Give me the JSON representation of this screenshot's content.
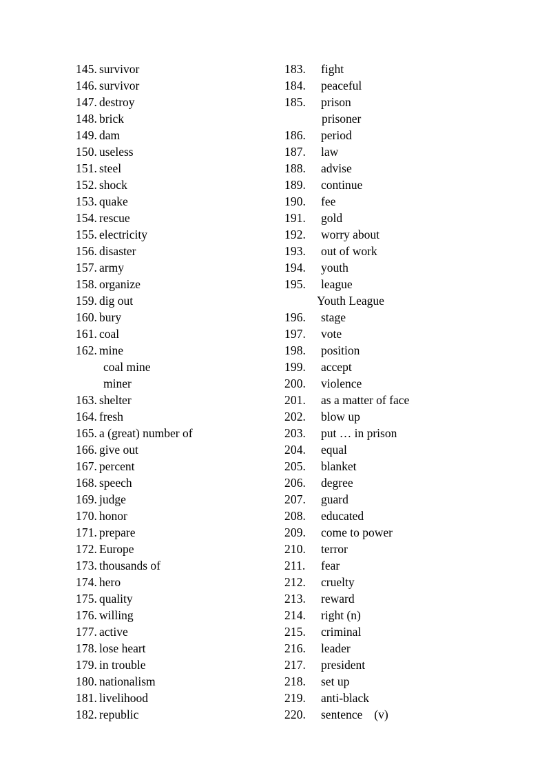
{
  "document": {
    "type": "vocabulary-word-list",
    "page_background": "#ffffff",
    "text_color": "#000000",
    "column_count": 2
  },
  "columns": [
    {
      "name": "left-column",
      "entries": [
        {
          "num": "145.",
          "word": "survivor"
        },
        {
          "num": "146.",
          "word": "survivor"
        },
        {
          "num": "147.",
          "word": "destroy"
        },
        {
          "num": "148.",
          "word": "brick"
        },
        {
          "num": "149.",
          "word": "dam"
        },
        {
          "num": "150.",
          "word": "useless"
        },
        {
          "num": "151.",
          "word": "steel"
        },
        {
          "num": "152.",
          "word": "shock"
        },
        {
          "num": "153.",
          "word": "quake"
        },
        {
          "num": "154.",
          "word": "rescue"
        },
        {
          "num": "155.",
          "word": "electricity"
        },
        {
          "num": "156.",
          "word": "disaster"
        },
        {
          "num": "157.",
          "word": "army"
        },
        {
          "num": "158.",
          "word": "organize"
        },
        {
          "num": "159.",
          "word": "dig out"
        },
        {
          "num": "160.",
          "word": "bury"
        },
        {
          "num": "161.",
          "word": "coal"
        },
        {
          "num": "162.",
          "word": "mine"
        },
        {
          "num": "",
          "word": "coal mine",
          "sub": true
        },
        {
          "num": "",
          "word": "miner",
          "sub": true
        },
        {
          "num": "163.",
          "word": "shelter"
        },
        {
          "num": "164.",
          "word": "fresh"
        },
        {
          "num": "165.",
          "word": "a (great) number of"
        },
        {
          "num": "166.",
          "word": "give out"
        },
        {
          "num": "167.",
          "word": "percent"
        },
        {
          "num": "168.",
          "word": "speech"
        },
        {
          "num": "169.",
          "word": "judge"
        },
        {
          "num": "170.",
          "word": "honor"
        },
        {
          "num": "171.",
          "word": "prepare"
        },
        {
          "num": "172.",
          "word": "Europe"
        },
        {
          "num": "173.",
          "word": "thousands of"
        },
        {
          "num": "174.",
          "word": "hero"
        },
        {
          "num": "175.",
          "word": "quality"
        },
        {
          "num": "176.",
          "word": "willing"
        },
        {
          "num": "177.",
          "word": "active"
        },
        {
          "num": "178.",
          "word": "lose heart"
        },
        {
          "num": "179.",
          "word": "in trouble"
        },
        {
          "num": "180.",
          "word": "nationalism"
        },
        {
          "num": "181.",
          "word": "livelihood"
        },
        {
          "num": "182.",
          "word": "republic"
        }
      ]
    },
    {
      "name": "right-column",
      "entries": [
        {
          "num": "183.",
          "word": "fight"
        },
        {
          "num": "184.",
          "word": "peaceful"
        },
        {
          "num": "185.",
          "word": "prison"
        },
        {
          "num": "",
          "word": "prisoner",
          "sub": true
        },
        {
          "num": "186.",
          "word": "period"
        },
        {
          "num": "187.",
          "word": "law"
        },
        {
          "num": "188.",
          "word": "advise"
        },
        {
          "num": "189.",
          "word": "continue"
        },
        {
          "num": "190.",
          "word": "fee"
        },
        {
          "num": "191.",
          "word": "gold"
        },
        {
          "num": "192.",
          "word": "worry about"
        },
        {
          "num": "193.",
          "word": "out of work"
        },
        {
          "num": "194.",
          "word": "youth"
        },
        {
          "num": "195.",
          "word": "league"
        },
        {
          "num": "",
          "word": "Youth League",
          "sub": true,
          "flush": true
        },
        {
          "num": "196.",
          "word": "stage"
        },
        {
          "num": "197.",
          "word": "vote"
        },
        {
          "num": "198.",
          "word": "position"
        },
        {
          "num": "199.",
          "word": "accept"
        },
        {
          "num": "200.",
          "word": "violence"
        },
        {
          "num": "201.",
          "word": "as a matter of face"
        },
        {
          "num": "202.",
          "word": "blow up"
        },
        {
          "num": "203.",
          "word": "put … in prison"
        },
        {
          "num": "204.",
          "word": "equal"
        },
        {
          "num": "205.",
          "word": "blanket"
        },
        {
          "num": "206.",
          "word": "degree"
        },
        {
          "num": "207.",
          "word": "guard"
        },
        {
          "num": "208.",
          "word": "educated"
        },
        {
          "num": "209.",
          "word": "come to power"
        },
        {
          "num": "210.",
          "word": "terror"
        },
        {
          "num": "211.",
          "word": "fear"
        },
        {
          "num": "212.",
          "word": "cruelty"
        },
        {
          "num": "213.",
          "word": "reward"
        },
        {
          "num": "214.",
          "word": "right (n)"
        },
        {
          "num": "215.",
          "word": "criminal"
        },
        {
          "num": "216.",
          "word": "leader"
        },
        {
          "num": "217.",
          "word": "president"
        },
        {
          "num": "218.",
          "word": "set up"
        },
        {
          "num": "219.",
          "word": "anti-black"
        },
        {
          "num": "220.",
          "word": "sentence",
          "suffix": "(v)"
        }
      ]
    }
  ]
}
